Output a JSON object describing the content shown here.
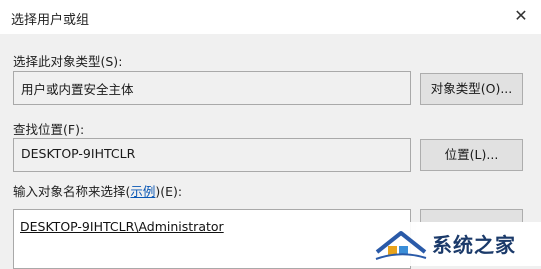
{
  "window": {
    "title": "选择用户或组",
    "close_glyph": "✕"
  },
  "object_type": {
    "label": "选择此对象类型(S):",
    "value": "用户或内置安全主体",
    "button_label": "对象类型(O)..."
  },
  "location": {
    "label": "查找位置(F):",
    "value": "DESKTOP-9IHTCLR",
    "button_label": "位置(L)..."
  },
  "names": {
    "label_prefix": "输入对象名称来选择(",
    "link": "示例",
    "label_suffix": ")(E):",
    "value": "DESKTOP-9IHTCLR\\Administrator"
  },
  "watermark": {
    "text": "系统之家"
  },
  "colors": {
    "link": "#0a57b5",
    "watermark_text": "#1b3a6a"
  }
}
